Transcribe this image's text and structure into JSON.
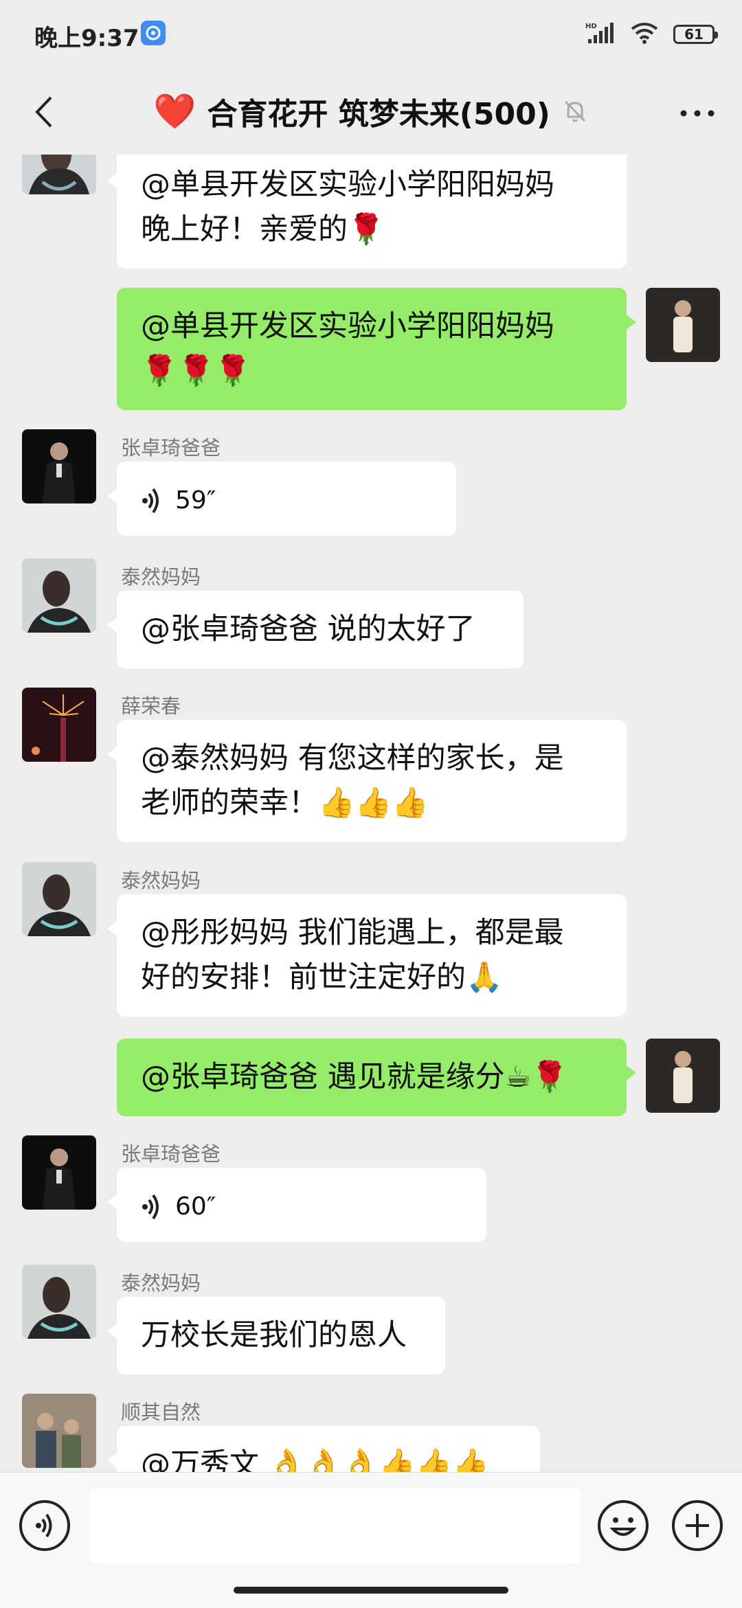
{
  "status_bar": {
    "time": "晚上9:37",
    "battery": "61",
    "network": "HD"
  },
  "header": {
    "title": "合育花开 筑梦未来(500)",
    "heart": "❤️"
  },
  "messages": [
    {
      "side": "left",
      "sender": "",
      "lines": [
        "@单县开发区实验小学阳阳妈妈",
        "晚上好！亲爱的🌹"
      ]
    },
    {
      "side": "right",
      "lines": [
        "@单县开发区实验小学阳阳妈妈",
        "🌹🌹🌹"
      ]
    },
    {
      "side": "left",
      "sender": "张卓琦爸爸",
      "voice_duration": "59″"
    },
    {
      "side": "left",
      "sender": "泰然妈妈",
      "lines": [
        "@张卓琦爸爸  说的太好了"
      ]
    },
    {
      "side": "left",
      "sender": "薛荣春",
      "lines": [
        "@泰然妈妈  有您这样的家长，是",
        "老师的荣幸！👍👍👍"
      ]
    },
    {
      "side": "left",
      "sender": "泰然妈妈",
      "lines": [
        "@彤彤妈妈  我们能遇上，都是最",
        "好的安排！前世注定好的🙏"
      ]
    },
    {
      "side": "right",
      "lines": [
        "@张卓琦爸爸  遇见就是缘分☕🌹"
      ]
    },
    {
      "side": "left",
      "sender": "张卓琦爸爸",
      "voice_duration": "60″"
    },
    {
      "side": "left",
      "sender": "泰然妈妈",
      "lines": [
        "万校长是我们的恩人"
      ]
    },
    {
      "side": "left",
      "sender": "顺其自然",
      "lines": [
        "@万秀文  👌👌👌👍👍👍"
      ]
    }
  ],
  "colors": {
    "bg": "#ededed",
    "my_bubble": "#95ec69",
    "other_bubble": "#ffffff",
    "sender_text": "#7a7a7a"
  },
  "icons": [
    "back-arrow-icon",
    "heart-icon",
    "mute-bell-icon",
    "more-icon",
    "voice-icon",
    "emoji-icon",
    "plus-icon"
  ]
}
